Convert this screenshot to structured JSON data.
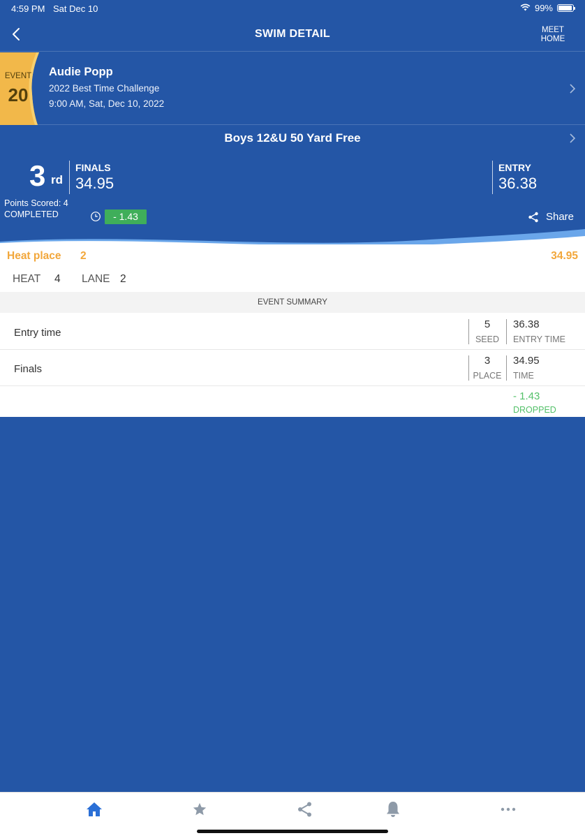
{
  "status_bar": {
    "time": "4:59 PM",
    "date": "Sat Dec 10",
    "battery": "99%",
    "battery_level": 0.99
  },
  "nav": {
    "title": "SWIM DETAIL",
    "meet_home_line1": "MEET",
    "meet_home_line2": "HOME"
  },
  "event": {
    "label": "EVENT",
    "number": "20",
    "swimmer": "Audie Popp",
    "meet": "2022 Best Time Challenge",
    "datetime": "9:00 AM, Sat, Dec 10, 2022",
    "title": "Boys 12&U 50 Yard Free"
  },
  "result": {
    "place": "3",
    "place_suffix": "rd",
    "finals_label": "FINALS",
    "finals_time": "34.95",
    "entry_label": "ENTRY",
    "entry_time": "36.38",
    "points": "Points Scored: 4",
    "status": "COMPLETED",
    "improvement": "- 1.43",
    "share_label": "Share"
  },
  "heat": {
    "place_label": "Heat place",
    "place_value": "2",
    "time": "34.95",
    "heat_label": "HEAT",
    "heat_value": "4",
    "lane_label": "LANE",
    "lane_value": "2"
  },
  "summary": {
    "header": "EVENT SUMMARY",
    "rows": [
      {
        "label": "Entry time",
        "num": "5",
        "num_sub": "SEED",
        "time": "36.38",
        "time_sub": "ENTRY TIME"
      },
      {
        "label": "Finals",
        "num": "3",
        "num_sub": "PLACE",
        "time": "34.95",
        "time_sub": "TIME"
      }
    ],
    "dropped_value": "- 1.43",
    "dropped_label": "DROPPED"
  },
  "tabs": [
    {
      "icon": "home-icon",
      "active": true
    },
    {
      "icon": "star-icon",
      "active": false
    },
    {
      "icon": "share-icon",
      "active": false
    },
    {
      "icon": "bell-icon",
      "active": false
    },
    {
      "icon": "more-icon",
      "active": false
    }
  ],
  "colors": {
    "primary": "#2456a6",
    "gold": "#f2a73b",
    "green": "#3fae5a",
    "active_tab": "#2a6fd6",
    "inactive_tab": "#8e9aa8"
  }
}
